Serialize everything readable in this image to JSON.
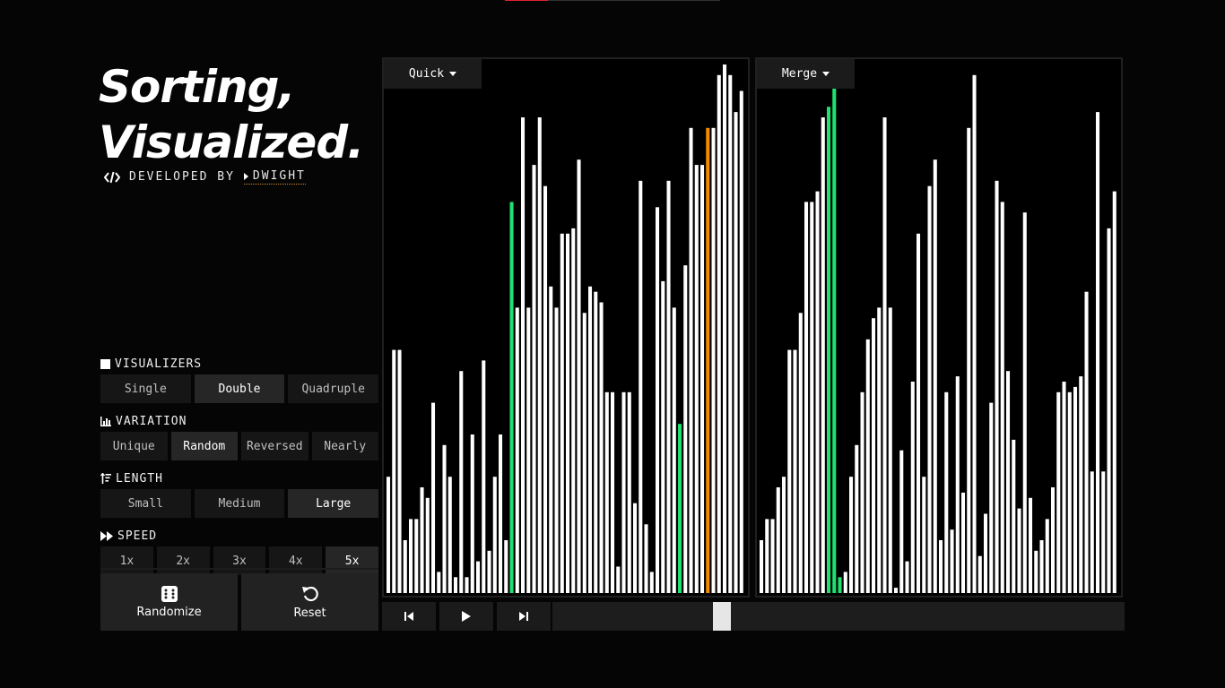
{
  "app": {
    "title_line1": "Sorting,",
    "title_line2": "Visualized.",
    "credit_prefix": "DEVELOPED BY",
    "credit_author": "DWIGHT"
  },
  "controls": {
    "visualizers": {
      "label": "VISUALIZERS",
      "options": [
        "Single",
        "Double",
        "Quadruple"
      ],
      "selected": "Double"
    },
    "variation": {
      "label": "VARIATION",
      "options": [
        "Unique",
        "Random",
        "Reversed",
        "Nearly"
      ],
      "selected": "Random"
    },
    "length": {
      "label": "LENGTH",
      "options": [
        "Small",
        "Medium",
        "Large"
      ],
      "selected": "Large"
    },
    "speed": {
      "label": "SPEED",
      "options": [
        "1x",
        "2x",
        "3x",
        "4x",
        "5x"
      ],
      "selected": "5x"
    },
    "randomize_label": "Randomize",
    "reset_label": "Reset"
  },
  "colors": {
    "bar": "#ffffff",
    "compare": "#20e070",
    "pivot": "#f08c00",
    "accent": "#e0242e"
  },
  "visualizers": [
    {
      "algorithm": "Quick",
      "values": [
        22,
        46,
        46,
        10,
        14,
        14,
        20,
        18,
        36,
        4,
        28,
        22,
        3,
        42,
        3,
        30,
        6,
        44,
        8,
        22,
        30,
        10,
        74,
        54,
        90,
        54,
        81,
        90,
        77,
        58,
        54,
        68,
        68,
        69,
        82,
        53,
        58,
        57,
        55,
        38,
        38,
        5,
        38,
        38,
        17,
        78,
        13,
        4,
        73,
        59,
        78,
        54,
        32,
        62,
        88,
        81,
        81,
        88,
        88,
        98,
        100,
        98,
        91,
        95
      ],
      "highlights": {
        "51": "compare",
        "52": "compare",
        "62": "pivot"
      }
    },
    {
      "algorithm": "Merge",
      "values": [
        10,
        14,
        14,
        20,
        22,
        46,
        46,
        53,
        74,
        74,
        76,
        90,
        92,
        100,
        3,
        4,
        22,
        28,
        38,
        48,
        52,
        54,
        90,
        54,
        1,
        27,
        6,
        40,
        68,
        22,
        77,
        82,
        10,
        38,
        12,
        41,
        19,
        88,
        98,
        7,
        15,
        36,
        78,
        74,
        42,
        29,
        16,
        72,
        18,
        8,
        10,
        14,
        20,
        38,
        40,
        38,
        39,
        41,
        57,
        23,
        91,
        23,
        69,
        76
      ]
    }
  ],
  "visualizer_highlights": [
    {
      "indices": [
        22
      ],
      "role": "compare"
    },
    {
      "indices": [
        57
      ],
      "role": "pivot"
    }
  ],
  "merge_highlights": {
    "indices": [
      12,
      13,
      14
    ],
    "role": "compare"
  },
  "player": {
    "progress": 0.29
  }
}
